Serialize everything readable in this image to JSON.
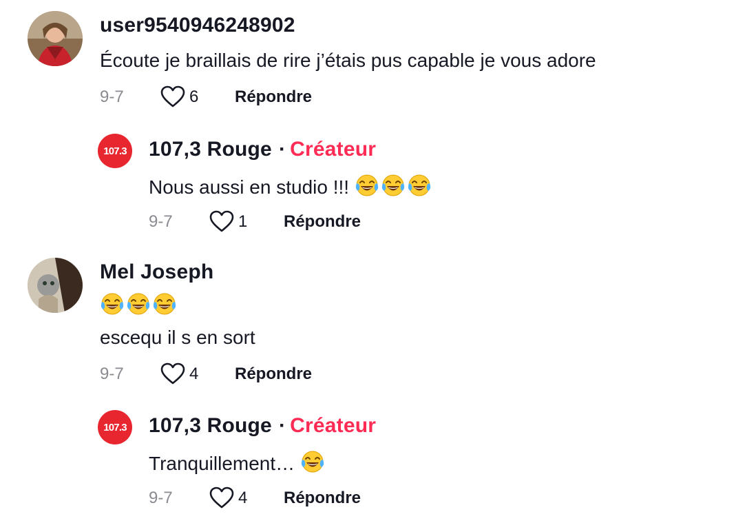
{
  "comments": [
    {
      "username": "user9540946248902",
      "text": "Écoute je braillais de rire j’étais pus capable je vous adore",
      "date": "9-7",
      "likes": "6",
      "reply_label": "Répondre"
    },
    {
      "avatar_text": "107.3",
      "username": "107,3 Rouge",
      "separator": "·",
      "creator_label": "Créateur",
      "text": "Nous aussi en studio !!!",
      "emoji_count": 3,
      "date": "9-7",
      "likes": "1",
      "reply_label": "Répondre"
    },
    {
      "username": "Mel Joseph",
      "emoji_count": 3,
      "text": "escequ il s en sort",
      "date": "9-7",
      "likes": "4",
      "reply_label": "Répondre"
    },
    {
      "avatar_text": "107.3",
      "username": "107,3 Rouge",
      "separator": "·",
      "creator_label": "Créateur",
      "text": "Tranquillement…",
      "emoji_count": 1,
      "date": "9-7",
      "likes": "4",
      "reply_label": "Répondre"
    }
  ],
  "icons": {
    "like": "heart-outline-icon",
    "emoji": "face-with-tears-of-joy-emoji"
  },
  "colors": {
    "creator": "#fe2c55",
    "badge": "#e8262f",
    "muted": "#8a8b91",
    "text": "#161823"
  }
}
